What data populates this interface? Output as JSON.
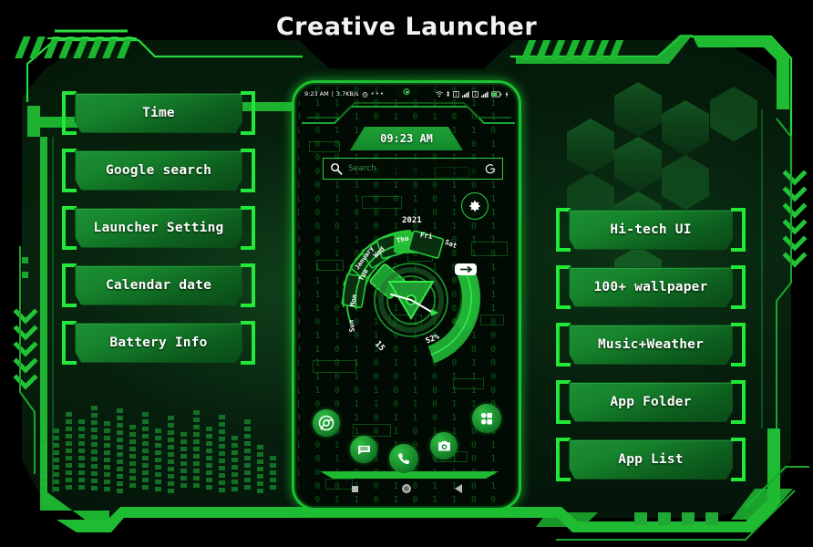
{
  "app": {
    "title": "Creative Launcher",
    "accent_green": "#22e838",
    "plate_green": "#16842c",
    "bg_black": "#000000",
    "text_white": "#ffffff"
  },
  "left_buttons": [
    {
      "label": "Time",
      "icon": "clock-icon"
    },
    {
      "label": "Google search",
      "icon": "search-icon"
    },
    {
      "label": "Launcher Setting",
      "icon": "gear-icon"
    },
    {
      "label": "Calendar date",
      "icon": "calendar-icon"
    },
    {
      "label": "Battery Info",
      "icon": "battery-icon"
    }
  ],
  "right_buttons": [
    {
      "label": "Hi-tech UI",
      "icon": "hexagon-icon"
    },
    {
      "label": "100+ wallpaper",
      "icon": "image-icon"
    },
    {
      "label": "Music+Weather",
      "icon": "music-icon"
    },
    {
      "label": "App Folder",
      "icon": "folder-icon"
    },
    {
      "label": "App List",
      "icon": "list-icon"
    }
  ],
  "phone": {
    "statusbar": {
      "time": "9:23 AM",
      "separator": "|",
      "netspeed": "3.7KB/s",
      "alarm_icon": "alarm-icon",
      "overflow_dots": "•••",
      "icons": [
        "wifi-icon",
        "bluetooth-icon",
        "sim1-signal-icon",
        "sim2-signal-icon",
        "battery-icon",
        "charging-bolt-icon"
      ]
    },
    "clock_widget": {
      "time": "09:23 AM"
    },
    "search": {
      "placeholder": "Search",
      "left_icon": "magnifier-icon",
      "right_icon": "google-g-icon"
    },
    "settings_button": {
      "icon": "gear-icon"
    },
    "calendar_widget": {
      "year": "2021",
      "month": "January",
      "date": "15",
      "days": [
        "Sun",
        "Mon",
        "Tue",
        "Wed",
        "Thu",
        "Fri",
        "Sat"
      ],
      "active_day": "Fri",
      "battery_percent": "52%",
      "battery_icon": "battery-icon",
      "center_icon": "triangle-compass-icon"
    },
    "dock": [
      {
        "name": "chrome",
        "icon": "chrome-icon"
      },
      {
        "name": "messages",
        "icon": "message-icon"
      },
      {
        "name": "phone",
        "icon": "phone-icon"
      },
      {
        "name": "camera",
        "icon": "camera-icon"
      },
      {
        "name": "app-drawer",
        "icon": "app-grid-icon"
      }
    ],
    "navbar": [
      {
        "name": "recents",
        "icon": "square-icon"
      },
      {
        "name": "home",
        "icon": "circle-icon"
      },
      {
        "name": "back",
        "icon": "triangle-icon"
      }
    ]
  },
  "wallpaper": {
    "bits": "1 0 1 0 1 1 0 1 0 0 1 0 1 1 0 0 1 0 1 0 1 1 0 0 1 1 0 1 0 1 0 0 1 1 0 1 1 0 0 1 0 1 1 0 1 0 0 1 1 0 1 0 1 0 1 1 0 0 1 0 1 1 0 1 0 1 0 0 1 1 0 1 0 1 1 0 0 1 0 1 1 0 1 0 0 1 0 1 1 0 1 1 0 0 1 0 1 0 1 1 0 1 0 0 1 1 0 1 0 1 1 0 0 1 0 1 0 1 1 0 1 0 0 1 1 0 1 0 1 0 1 1 0 0 1 0 1 1 0 1 0 1 0 0 1 1 0 1 0 1 1 0 0 1 0 1 1 0 1 0 0 1 0 1 1 0 1 1 0 0 1 0 1 0 1 1 0 1 0 0 1 1 0 1 0 1 1 0 0 1 0 1 0 1 1 0 1 0 0 1 1 0 1 0 1 0 1 1 0 0 1 0 1 1 0 1 0 1 0 0 1 1 0 1 0 1 1 0 0 1 0 1 1 0 1 0 0 1 0 1 1 0 1 1 0 0 1 0 1 0 1 1 0 1 0 0 1 1 0 1 0 1 1 0 0 1 0 1 0 1 1 0 1 0 0 1 1 0 1 0 1 0 1 1 0 0 1 0 1 1 0 1 0 1 0 0 1 1 0 1 0 1 1 0 0 1 0 1 1 0 1 0 0 1 0 1 1 0 1 1 0 0 1 0 1 0 1 1 0 1 0 0 1 1 0 1 0 1 1 0 0 1 0 1 0 1 1 0 1 0 0 1 1 0 1 0 1 0 1 1 0 0 1 0 1 1 0 1 0 1 0 0 1 1 0 1 0 1 1 0 0 1 0 1 1 0 1 0 0 1 0 1 1 0 1 1 0 0 1 0 1 0 1 1 0 1 0 0 1 1 0 1 0 1 1 0 0 1 0"
  }
}
